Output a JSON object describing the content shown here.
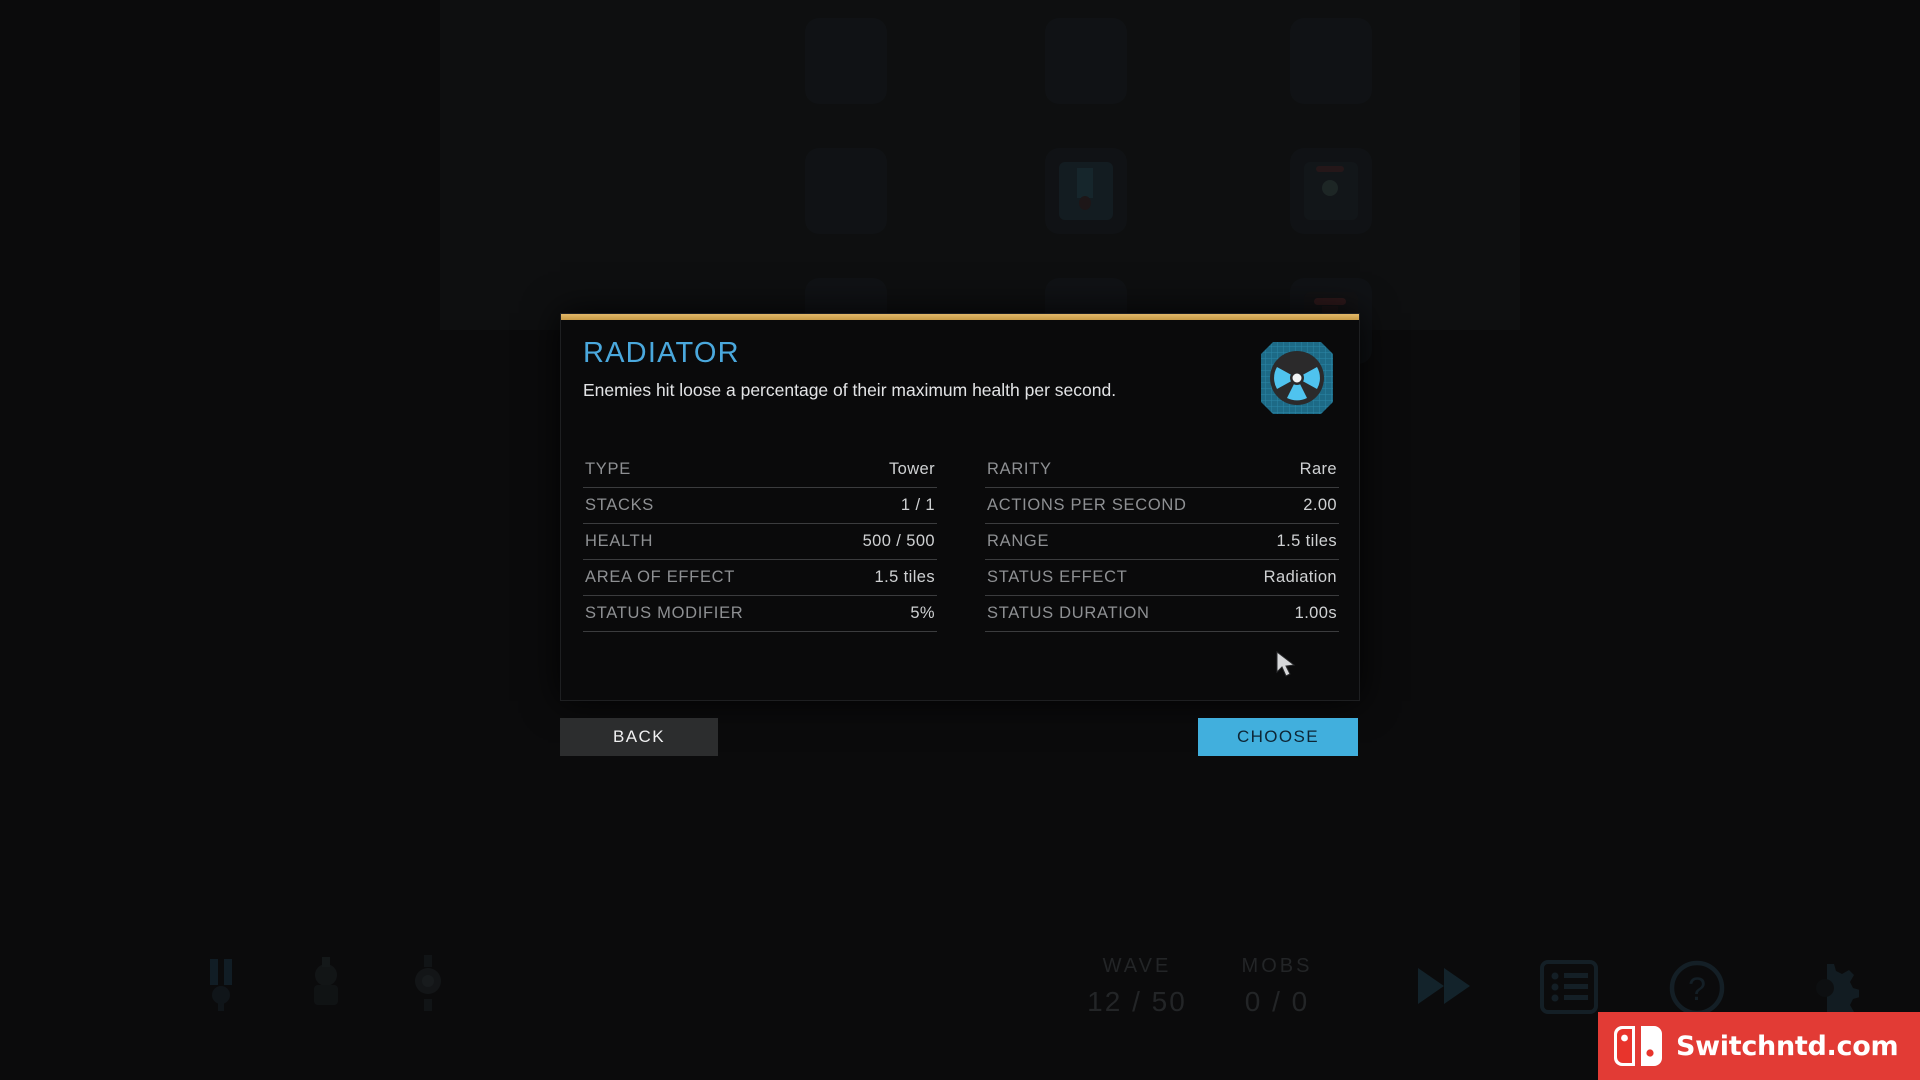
{
  "dialog": {
    "title": "RADIATOR",
    "description": "Enemies hit loose a percentage of their maximum health per second.",
    "icon_name": "radiation-trefoil-icon",
    "accent_color": "#4aa8dd",
    "top_bar_color": "#d8ab55",
    "stats_left": [
      {
        "label": "TYPE",
        "value": "Tower"
      },
      {
        "label": "STACKS",
        "value": "1 / 1"
      },
      {
        "label": "HEALTH",
        "value": "500 / 500"
      },
      {
        "label": "AREA OF EFFECT",
        "value": "1.5 tiles"
      },
      {
        "label": "STATUS MODIFIER",
        "value": "5%"
      }
    ],
    "stats_right": [
      {
        "label": "RARITY",
        "value": "Rare"
      },
      {
        "label": "ACTIONS PER SECOND",
        "value": "2.00"
      },
      {
        "label": "RANGE",
        "value": "1.5 tiles"
      },
      {
        "label": "STATUS EFFECT",
        "value": "Radiation"
      },
      {
        "label": "STATUS DURATION",
        "value": "1.00s"
      }
    ],
    "buttons": {
      "back": "BACK",
      "choose": "CHOOSE",
      "choose_color": "#41afdd",
      "back_color": "#2c2d2e"
    }
  },
  "hud": {
    "wave_label": "WAVE",
    "wave_value": "12 / 50",
    "mobs_label": "MOBS",
    "mobs_value": "0 / 0",
    "icons": [
      "fast-forward-icon",
      "stats-list-icon",
      "help-question-icon",
      "settings-gear-icon"
    ]
  },
  "watermark": {
    "text": "Switchntd.com",
    "background_color": "#e23b35",
    "logo_name": "nintendo-switch-joycon-logo"
  }
}
